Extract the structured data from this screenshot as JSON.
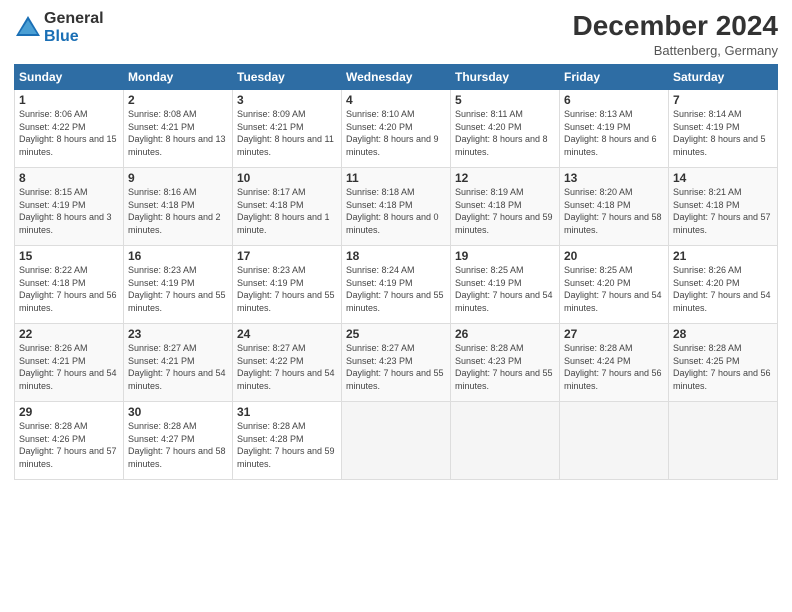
{
  "header": {
    "logo_line1": "General",
    "logo_line2": "Blue",
    "month": "December 2024",
    "location": "Battenberg, Germany"
  },
  "weekdays": [
    "Sunday",
    "Monday",
    "Tuesday",
    "Wednesday",
    "Thursday",
    "Friday",
    "Saturday"
  ],
  "weeks": [
    [
      {
        "day": "1",
        "sunrise": "8:06 AM",
        "sunset": "4:22 PM",
        "daylight": "8 hours and 15 minutes."
      },
      {
        "day": "2",
        "sunrise": "8:08 AM",
        "sunset": "4:21 PM",
        "daylight": "8 hours and 13 minutes."
      },
      {
        "day": "3",
        "sunrise": "8:09 AM",
        "sunset": "4:21 PM",
        "daylight": "8 hours and 11 minutes."
      },
      {
        "day": "4",
        "sunrise": "8:10 AM",
        "sunset": "4:20 PM",
        "daylight": "8 hours and 9 minutes."
      },
      {
        "day": "5",
        "sunrise": "8:11 AM",
        "sunset": "4:20 PM",
        "daylight": "8 hours and 8 minutes."
      },
      {
        "day": "6",
        "sunrise": "8:13 AM",
        "sunset": "4:19 PM",
        "daylight": "8 hours and 6 minutes."
      },
      {
        "day": "7",
        "sunrise": "8:14 AM",
        "sunset": "4:19 PM",
        "daylight": "8 hours and 5 minutes."
      }
    ],
    [
      {
        "day": "8",
        "sunrise": "8:15 AM",
        "sunset": "4:19 PM",
        "daylight": "8 hours and 3 minutes."
      },
      {
        "day": "9",
        "sunrise": "8:16 AM",
        "sunset": "4:18 PM",
        "daylight": "8 hours and 2 minutes."
      },
      {
        "day": "10",
        "sunrise": "8:17 AM",
        "sunset": "4:18 PM",
        "daylight": "8 hours and 1 minute."
      },
      {
        "day": "11",
        "sunrise": "8:18 AM",
        "sunset": "4:18 PM",
        "daylight": "8 hours and 0 minutes."
      },
      {
        "day": "12",
        "sunrise": "8:19 AM",
        "sunset": "4:18 PM",
        "daylight": "7 hours and 59 minutes."
      },
      {
        "day": "13",
        "sunrise": "8:20 AM",
        "sunset": "4:18 PM",
        "daylight": "7 hours and 58 minutes."
      },
      {
        "day": "14",
        "sunrise": "8:21 AM",
        "sunset": "4:18 PM",
        "daylight": "7 hours and 57 minutes."
      }
    ],
    [
      {
        "day": "15",
        "sunrise": "8:22 AM",
        "sunset": "4:18 PM",
        "daylight": "7 hours and 56 minutes."
      },
      {
        "day": "16",
        "sunrise": "8:23 AM",
        "sunset": "4:19 PM",
        "daylight": "7 hours and 55 minutes."
      },
      {
        "day": "17",
        "sunrise": "8:23 AM",
        "sunset": "4:19 PM",
        "daylight": "7 hours and 55 minutes."
      },
      {
        "day": "18",
        "sunrise": "8:24 AM",
        "sunset": "4:19 PM",
        "daylight": "7 hours and 55 minutes."
      },
      {
        "day": "19",
        "sunrise": "8:25 AM",
        "sunset": "4:19 PM",
        "daylight": "7 hours and 54 minutes."
      },
      {
        "day": "20",
        "sunrise": "8:25 AM",
        "sunset": "4:20 PM",
        "daylight": "7 hours and 54 minutes."
      },
      {
        "day": "21",
        "sunrise": "8:26 AM",
        "sunset": "4:20 PM",
        "daylight": "7 hours and 54 minutes."
      }
    ],
    [
      {
        "day": "22",
        "sunrise": "8:26 AM",
        "sunset": "4:21 PM",
        "daylight": "7 hours and 54 minutes."
      },
      {
        "day": "23",
        "sunrise": "8:27 AM",
        "sunset": "4:21 PM",
        "daylight": "7 hours and 54 minutes."
      },
      {
        "day": "24",
        "sunrise": "8:27 AM",
        "sunset": "4:22 PM",
        "daylight": "7 hours and 54 minutes."
      },
      {
        "day": "25",
        "sunrise": "8:27 AM",
        "sunset": "4:23 PM",
        "daylight": "7 hours and 55 minutes."
      },
      {
        "day": "26",
        "sunrise": "8:28 AM",
        "sunset": "4:23 PM",
        "daylight": "7 hours and 55 minutes."
      },
      {
        "day": "27",
        "sunrise": "8:28 AM",
        "sunset": "4:24 PM",
        "daylight": "7 hours and 56 minutes."
      },
      {
        "day": "28",
        "sunrise": "8:28 AM",
        "sunset": "4:25 PM",
        "daylight": "7 hours and 56 minutes."
      }
    ],
    [
      {
        "day": "29",
        "sunrise": "8:28 AM",
        "sunset": "4:26 PM",
        "daylight": "7 hours and 57 minutes."
      },
      {
        "day": "30",
        "sunrise": "8:28 AM",
        "sunset": "4:27 PM",
        "daylight": "7 hours and 58 minutes."
      },
      {
        "day": "31",
        "sunrise": "8:28 AM",
        "sunset": "4:28 PM",
        "daylight": "7 hours and 59 minutes."
      },
      null,
      null,
      null,
      null
    ]
  ]
}
